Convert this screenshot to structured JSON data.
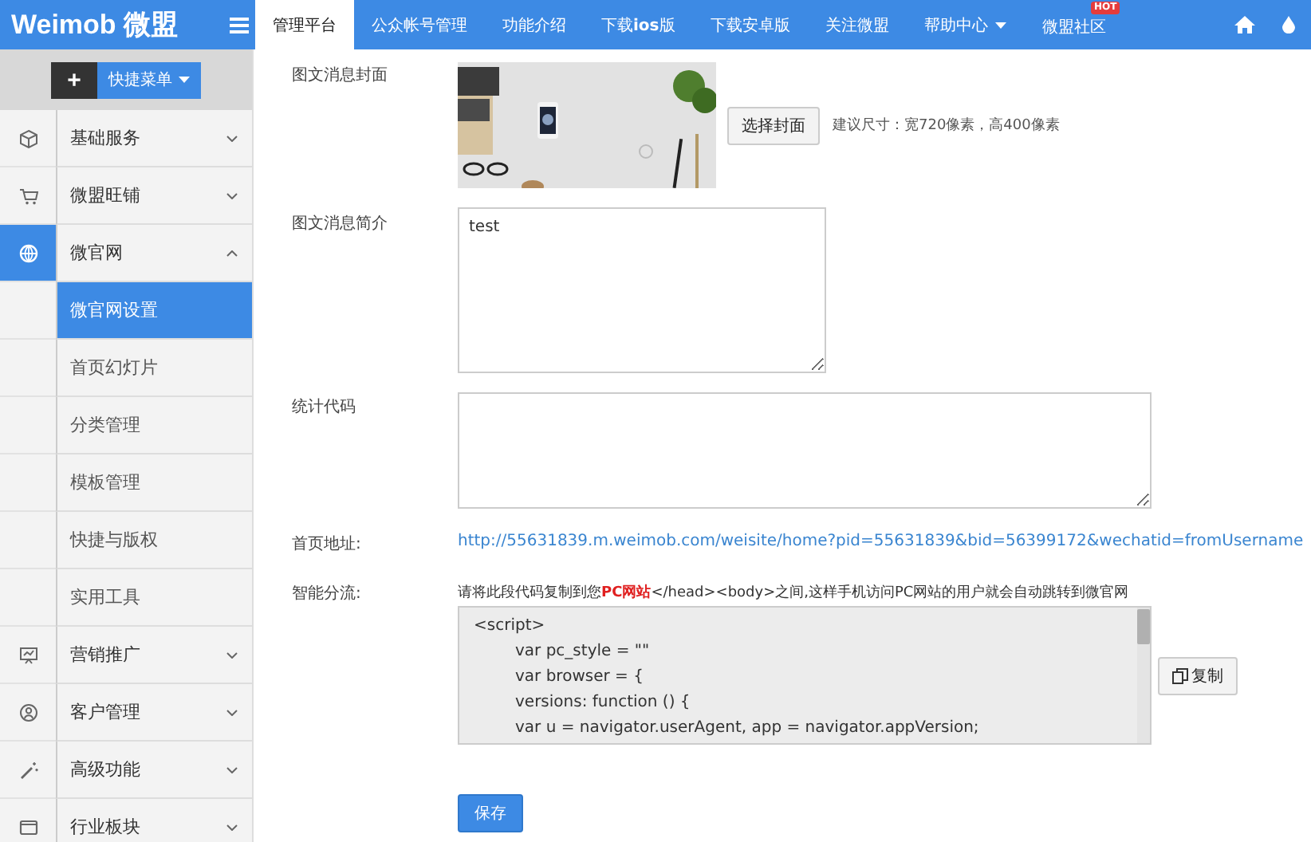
{
  "header": {
    "logo": "Weimob 微盟",
    "tabs": [
      {
        "label": "管理平台",
        "selected": true
      },
      {
        "label": "公众帐号管理",
        "selected": false
      },
      {
        "label": "功能介绍",
        "selected": false
      },
      {
        "label": "下载**ios**版",
        "selected": false
      },
      {
        "label": "下载安卓版",
        "selected": false
      },
      {
        "label": "关注微盟",
        "selected": false
      },
      {
        "label": "帮助中心",
        "selected": false,
        "dropdown": true
      },
      {
        "label": "微盟社区",
        "selected": false,
        "badge": "HOT"
      }
    ]
  },
  "sidebar": {
    "quick_menu": {
      "plus": "+",
      "label": "快捷菜单"
    },
    "items": [
      {
        "label": "基础服务",
        "expanded": false
      },
      {
        "label": "微盟旺铺",
        "expanded": false
      },
      {
        "label": "微官网",
        "expanded": true,
        "children": [
          {
            "label": "微官网设置",
            "selected": true
          },
          {
            "label": "首页幻灯片",
            "selected": false
          },
          {
            "label": "分类管理",
            "selected": false
          },
          {
            "label": "模板管理",
            "selected": false
          },
          {
            "label": "快捷与版权",
            "selected": false
          },
          {
            "label": "实用工具",
            "selected": false
          }
        ]
      },
      {
        "label": "营销推广",
        "expanded": false
      },
      {
        "label": "客户管理",
        "expanded": false
      },
      {
        "label": "高级功能",
        "expanded": false
      },
      {
        "label": "行业板块",
        "expanded": false
      }
    ]
  },
  "form": {
    "cover": {
      "label": "图文消息封面",
      "button": "选择封面",
      "hint": "建议尺寸：宽720像素，高400像素"
    },
    "summary": {
      "label": "图文消息简介",
      "value": "test"
    },
    "stats": {
      "label": "统计代码"
    },
    "home_url": {
      "label": "首页地址:",
      "link": "http://55631839.m.weimob.com/weisite/home?pid=55631839&bid=56399172&wechatid=fromUsername"
    },
    "routing": {
      "label": "智能分流:",
      "instruction": "请将此段代码复制到您**PC网站**</head><body>之间,这样手机访问PC网站的用户就会自动跳转到微官网",
      "code": [
        {
          "text": "<script>",
          "indented": false
        },
        {
          "text": "var pc_style = \"\"",
          "indented": true
        },
        {
          "text": "var browser = {",
          "indented": true
        },
        {
          "text": "versions: function () {",
          "indented": true
        },
        {
          "text": "var u = navigator.userAgent, app = navigator.appVersion;",
          "indented": true
        }
      ],
      "copy_button": "复制"
    },
    "save_button": "保存"
  }
}
